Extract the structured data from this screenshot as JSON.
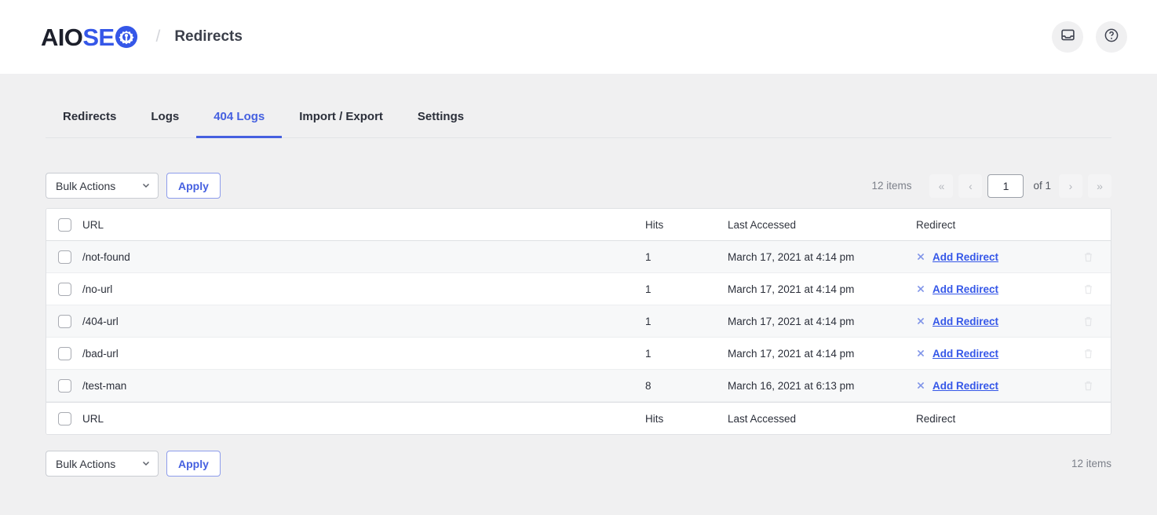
{
  "header": {
    "logo_primary": "AIO",
    "logo_secondary": "SE",
    "logo_icon": "gear-icon",
    "separator": "/",
    "breadcrumb_title": "Redirects",
    "actions": [
      {
        "name": "notifications-icon",
        "label": "inbox-icon"
      },
      {
        "name": "help-icon",
        "label": "question-circle-icon"
      }
    ]
  },
  "tabs": [
    {
      "label": "Redirects",
      "active": false
    },
    {
      "label": "Logs",
      "active": false
    },
    {
      "label": "404 Logs",
      "active": true
    },
    {
      "label": "Import / Export",
      "active": false
    },
    {
      "label": "Settings",
      "active": false
    }
  ],
  "toolbar": {
    "bulk_actions_label": "Bulk Actions",
    "apply_label": "Apply",
    "chevron_icon": "chevron-down-icon"
  },
  "pagination": {
    "items_count": "12 items",
    "first_label": "«",
    "prev_label": "‹",
    "current_page": "1",
    "of_label": "of 1",
    "next_label": "›",
    "last_label": "»"
  },
  "table": {
    "columns": {
      "url": "URL",
      "hits": "Hits",
      "last_accessed": "Last Accessed",
      "redirect": "Redirect"
    },
    "row_action_label": "Add Redirect",
    "rows": [
      {
        "url": "/not-found",
        "hits": "1",
        "last_accessed": "March 17, 2021 at 4:14 pm",
        "action": "Add Redirect"
      },
      {
        "url": "/no-url",
        "hits": "1",
        "last_accessed": "March 17, 2021 at 4:14 pm",
        "action": "Add Redirect"
      },
      {
        "url": "/404-url",
        "hits": "1",
        "last_accessed": "March 17, 2021 at 4:14 pm",
        "action": "Add Redirect"
      },
      {
        "url": "/bad-url",
        "hits": "1",
        "last_accessed": "March 17, 2021 at 4:14 pm",
        "action": "Add Redirect"
      },
      {
        "url": "/test-man",
        "hits": "8",
        "last_accessed": "March 16, 2021 at 6:13 pm",
        "action": "Add Redirect"
      }
    ]
  },
  "footer": {
    "bulk_actions_label": "Bulk Actions",
    "apply_label": "Apply",
    "items_count": "12 items"
  },
  "colors": {
    "accent": "#3557e8",
    "tab_active": "#4560e0",
    "page_bg": "#f0f0f1",
    "row_alt": "#f7f8f9",
    "text": "#2b2f3a",
    "muted": "#7c808a"
  }
}
